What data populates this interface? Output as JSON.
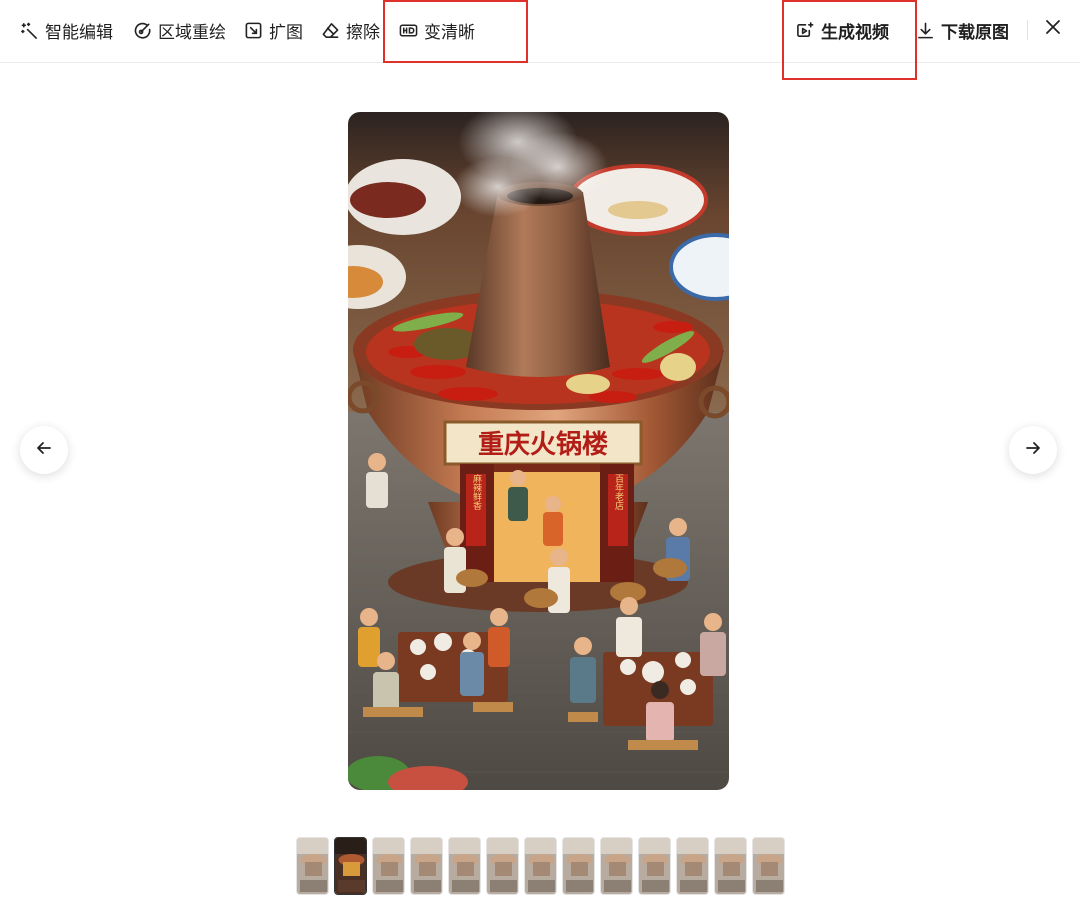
{
  "toolbar": {
    "smart_edit": {
      "label": "智能编辑",
      "icon": "magic-wand-icon"
    },
    "region_redraw": {
      "label": "区域重绘",
      "icon": "brush-target-icon"
    },
    "expand": {
      "label": "扩图",
      "icon": "expand-icon"
    },
    "erase": {
      "label": "擦除",
      "icon": "eraser-icon"
    },
    "enhance": {
      "label": "变清晰",
      "icon": "hd-icon"
    },
    "generate_video": {
      "label": "生成视频",
      "icon": "video-sparkle-icon"
    },
    "download_original": {
      "label": "下载原图",
      "icon": "download-icon"
    },
    "close_icon": "close-icon"
  },
  "highlight_color": "#e0302a",
  "main_image": {
    "sign_text": "重庆火锅楼",
    "banner_left": "麻辣鲜香",
    "banner_right": "百年老店"
  },
  "navigation": {
    "prev_icon": "arrow-left-icon",
    "next_icon": "arrow-right-icon"
  },
  "thumbnails": {
    "count": 13,
    "selected_index": 1
  }
}
